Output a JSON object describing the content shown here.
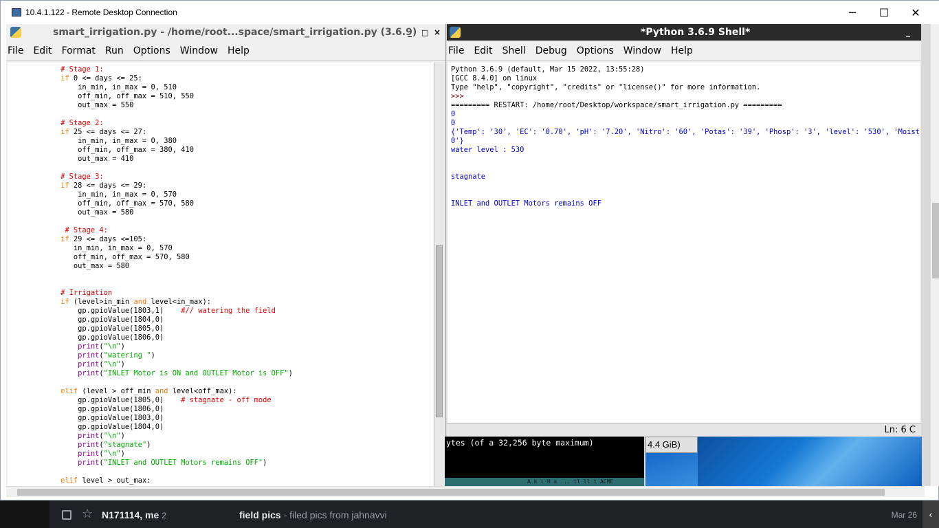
{
  "rdp": {
    "title": "10.4.1.122 - Remote Desktop Connection",
    "minimize": "─",
    "maximize": "☐",
    "close": "✕"
  },
  "editor": {
    "title": "smart_irrigation.py - /home/root...space/smart_irrigation.py (3.6.9)",
    "ctrl_min": "_",
    "ctrl_max": "□",
    "ctrl_close": "×",
    "menu": [
      "File",
      "Edit",
      "Format",
      "Run",
      "Options",
      "Window",
      "Help"
    ],
    "code": [
      [
        {
          "t": "            "
        },
        {
          "t": "# Stage 1:",
          "c": "cm"
        }
      ],
      [
        {
          "t": "            "
        },
        {
          "t": "if",
          "c": "kw"
        },
        {
          "t": " 0 <= days <= 25:"
        }
      ],
      [
        {
          "t": "                in_min, in_max = 0, 510"
        }
      ],
      [
        {
          "t": "                off_min, off_max = 510, 550"
        }
      ],
      [
        {
          "t": "                out_max = 550"
        }
      ],
      [
        {
          "t": ""
        }
      ],
      [
        {
          "t": "            "
        },
        {
          "t": "# Stage 2:",
          "c": "cm"
        }
      ],
      [
        {
          "t": "            "
        },
        {
          "t": "if",
          "c": "kw"
        },
        {
          "t": " 25 <= days <= 27:"
        }
      ],
      [
        {
          "t": "                in_min, in_max = 0, 380"
        }
      ],
      [
        {
          "t": "                off_min, off_max = 380, 410"
        }
      ],
      [
        {
          "t": "                out_max = 410"
        }
      ],
      [
        {
          "t": ""
        }
      ],
      [
        {
          "t": "            "
        },
        {
          "t": "# Stage 3:",
          "c": "cm"
        }
      ],
      [
        {
          "t": "            "
        },
        {
          "t": "if",
          "c": "kw"
        },
        {
          "t": " 28 <= days <= 29:"
        }
      ],
      [
        {
          "t": "                in_min, in_max = 0, 570"
        }
      ],
      [
        {
          "t": "                off_min, off_max = 570, 580"
        }
      ],
      [
        {
          "t": "                out_max = 580"
        }
      ],
      [
        {
          "t": ""
        }
      ],
      [
        {
          "t": "             "
        },
        {
          "t": "# Stage 4:",
          "c": "cm"
        }
      ],
      [
        {
          "t": "            "
        },
        {
          "t": "if",
          "c": "kw"
        },
        {
          "t": " 29 <= days <=105:"
        }
      ],
      [
        {
          "t": "               in_min, in_max = 0, 570"
        }
      ],
      [
        {
          "t": "               off_min, off_max = 570, 580"
        }
      ],
      [
        {
          "t": "               out_max = 580"
        }
      ],
      [
        {
          "t": ""
        }
      ],
      [
        {
          "t": ""
        }
      ],
      [
        {
          "t": "            "
        },
        {
          "t": "# Irrigation",
          "c": "cm"
        }
      ],
      [
        {
          "t": "            "
        },
        {
          "t": "if",
          "c": "kw"
        },
        {
          "t": " (level>in_min "
        },
        {
          "t": "and",
          "c": "kw"
        },
        {
          "t": " level<in_max):"
        }
      ],
      [
        {
          "t": "                gp.gpioValue(1803,1)    "
        },
        {
          "t": "#// watering the field",
          "c": "cm"
        }
      ],
      [
        {
          "t": "                gp.gpioValue(1804,0)"
        }
      ],
      [
        {
          "t": "                gp.gpioValue(1805,0)"
        }
      ],
      [
        {
          "t": "                gp.gpioValue(1806,0)"
        }
      ],
      [
        {
          "t": "                "
        },
        {
          "t": "print",
          "c": "bi"
        },
        {
          "t": "("
        },
        {
          "t": "\"\\n\"",
          "c": "st"
        },
        {
          "t": ")"
        }
      ],
      [
        {
          "t": "                "
        },
        {
          "t": "print",
          "c": "bi"
        },
        {
          "t": "("
        },
        {
          "t": "\"watering \"",
          "c": "st"
        },
        {
          "t": ")"
        }
      ],
      [
        {
          "t": "                "
        },
        {
          "t": "print",
          "c": "bi"
        },
        {
          "t": "("
        },
        {
          "t": "\"\\n\"",
          "c": "st"
        },
        {
          "t": ")"
        }
      ],
      [
        {
          "t": "                "
        },
        {
          "t": "print",
          "c": "bi"
        },
        {
          "t": "("
        },
        {
          "t": "\"INLET Motor is ON and OUTLET Motor is OFF\"",
          "c": "st"
        },
        {
          "t": ")"
        }
      ],
      [
        {
          "t": ""
        }
      ],
      [
        {
          "t": "            "
        },
        {
          "t": "elif",
          "c": "kw"
        },
        {
          "t": " (level > off_min "
        },
        {
          "t": "and",
          "c": "kw"
        },
        {
          "t": " level<off_max):"
        }
      ],
      [
        {
          "t": "                gp.gpioValue(1805,0)    "
        },
        {
          "t": "# stagnate - off mode",
          "c": "cm"
        }
      ],
      [
        {
          "t": "                gp.gpioValue(1806,0)"
        }
      ],
      [
        {
          "t": "                gp.gpioValue(1803,0)"
        }
      ],
      [
        {
          "t": "                gp.gpioValue(1804,0)"
        }
      ],
      [
        {
          "t": "                "
        },
        {
          "t": "print",
          "c": "bi"
        },
        {
          "t": "("
        },
        {
          "t": "\"\\n\"",
          "c": "st"
        },
        {
          "t": ")"
        }
      ],
      [
        {
          "t": "                "
        },
        {
          "t": "print",
          "c": "bi"
        },
        {
          "t": "("
        },
        {
          "t": "\"stagnate\"",
          "c": "st"
        },
        {
          "t": ")"
        }
      ],
      [
        {
          "t": "                "
        },
        {
          "t": "print",
          "c": "bi"
        },
        {
          "t": "("
        },
        {
          "t": "\"\\n\"",
          "c": "st"
        },
        {
          "t": ")"
        }
      ],
      [
        {
          "t": "                "
        },
        {
          "t": "print",
          "c": "bi"
        },
        {
          "t": "("
        },
        {
          "t": "\"INLET and OUTLET Motors remains OFF\"",
          "c": "st"
        },
        {
          "t": ")"
        }
      ],
      [
        {
          "t": ""
        }
      ],
      [
        {
          "t": "            "
        },
        {
          "t": "elif",
          "c": "kw"
        },
        {
          "t": " level > out_max:"
        }
      ]
    ]
  },
  "shell": {
    "title": "*Python 3.6.9 Shell*",
    "ctrl_min": "_",
    "menu": [
      "File",
      "Edit",
      "Shell",
      "Debug",
      "Options",
      "Window",
      "Help"
    ],
    "lines": [
      {
        "t": "Python 3.6.9 (default, Mar 15 2022, 13:55:28)",
        "c": ""
      },
      {
        "t": "[GCC 8.4.0] on linux",
        "c": ""
      },
      {
        "t": "Type \"help\", \"copyright\", \"credits\" or \"license()\" for more information.",
        "c": ""
      },
      {
        "t": ">>> ",
        "c": "sh-prompt"
      },
      {
        "t": "========= RESTART: /home/root/Desktop/workspace/smart_irrigation.py =========",
        "c": ""
      },
      {
        "t": "0",
        "c": "sh-blue"
      },
      {
        "t": "0",
        "c": "sh-blue"
      },
      {
        "t": "{'Temp': '30', 'EC': '0.70', 'pH': '7.20', 'Nitro': '60', 'Potas': '39', 'Phosp': '3', 'level': '530', 'Moist': '3",
        "c": "sh-blue"
      },
      {
        "t": "0'}",
        "c": "sh-blue"
      },
      {
        "t": "water level : 530",
        "c": "sh-blue"
      },
      {
        "t": "",
        "c": ""
      },
      {
        "t": "",
        "c": ""
      },
      {
        "t": "stagnate",
        "c": "sh-blue"
      },
      {
        "t": "",
        "c": ""
      },
      {
        "t": "",
        "c": ""
      },
      {
        "t": "INLET and OUTLET Motors remains OFF",
        "c": "sh-blue"
      }
    ],
    "status": "Ln: 6   C"
  },
  "background": {
    "terminal_text": "ytes (of a 32,256 byte maximum)",
    "terminal_footer": "A  k  i  H  a  ...  tl  ll  t  ACME",
    "memory_text": "4.4 GiB)"
  },
  "gmail": {
    "sender": "N171114, me",
    "count": "2",
    "subject": "field pics",
    "snippet": " - filed pics from jahnavvi",
    "date": "Mar 26"
  },
  "colors": {
    "keyword": "#ff7700",
    "comment": "#dd0000",
    "string": "#00aa00",
    "builtin": "#900090",
    "shell_output": "#0000cc"
  }
}
